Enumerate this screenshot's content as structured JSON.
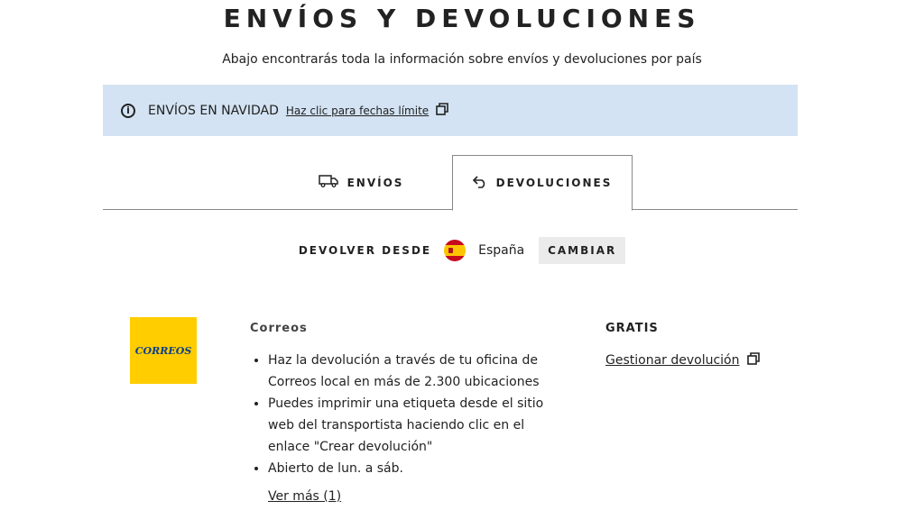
{
  "header": {
    "title": "ENVÍOS Y DEVOLUCIONES",
    "subtitle": "Abajo encontrarás toda la información sobre envíos y devoluciones por país"
  },
  "banner": {
    "title": "ENVÍOS EN NAVIDAD",
    "link": "Haz clic para fechas límite",
    "color": "#d3e3f3"
  },
  "tabs": [
    {
      "label": "ENVÍOS",
      "icon": "truck-icon",
      "selected": false
    },
    {
      "label": "DEVOLUCIONES",
      "icon": "return-arrow-icon",
      "selected": true
    }
  ],
  "country": {
    "label": "DEVOLVER DESDE",
    "name": "España",
    "flag": "spain-flag-icon",
    "change_label": "CAMBIAR"
  },
  "carrier": {
    "name": "Correos",
    "logo_text": "CORREOS",
    "logo_color": "#ffcd00",
    "features": [
      "Haz la devolución a través de tu oficina de Correos local en más de 2.300 ubicaciones",
      "Puedes imprimir una etiqueta desde el sitio web del transportista haciendo clic en el enlace \"Crear devolución\"",
      "Abierto de lun. a sáb."
    ],
    "see_more": "Ver más (1)",
    "price": "GRATIS",
    "manage_link": "Gestionar devolución"
  }
}
